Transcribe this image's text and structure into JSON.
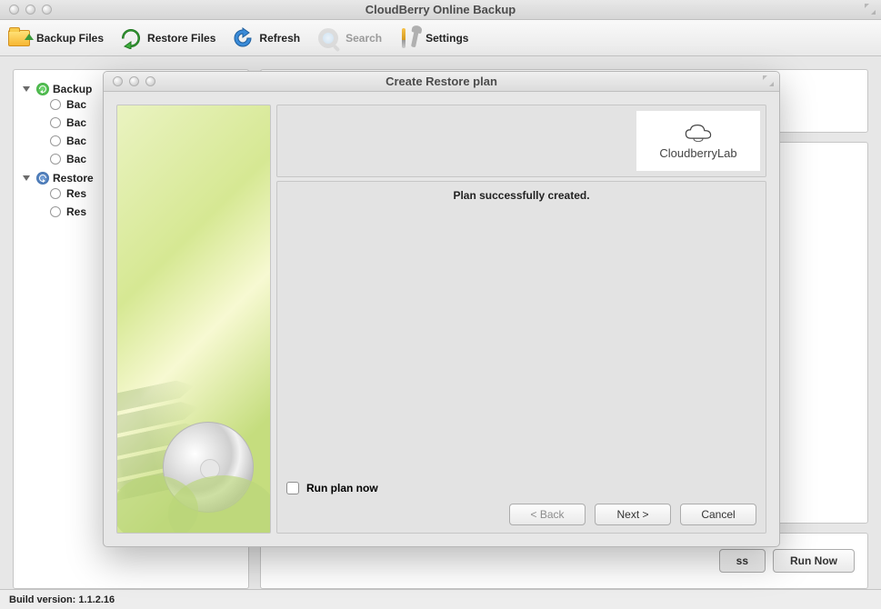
{
  "main_window": {
    "title": "CloudBerry Online Backup"
  },
  "toolbar": {
    "backup": "Backup Files",
    "restore": "Restore Files",
    "refresh": "Refresh",
    "search": "Search",
    "settings": "Settings"
  },
  "sidebar": {
    "backup_header": "Backup",
    "backup_items": [
      "Bac",
      "Bac",
      "Bac",
      "Bac"
    ],
    "restore_header": "Restore",
    "restore_items": [
      "Res",
      "Res"
    ]
  },
  "panel": {
    "right_button_partial": "ss",
    "run_now": "Run Now"
  },
  "footer": {
    "build": "Build version: 1.1.2.16"
  },
  "modal": {
    "title": "Create Restore plan",
    "brand": "CloudberryLab",
    "success": "Plan successfully created.",
    "run_checkbox": "Run plan now",
    "back": "< Back",
    "next": "Next >",
    "cancel": "Cancel"
  }
}
